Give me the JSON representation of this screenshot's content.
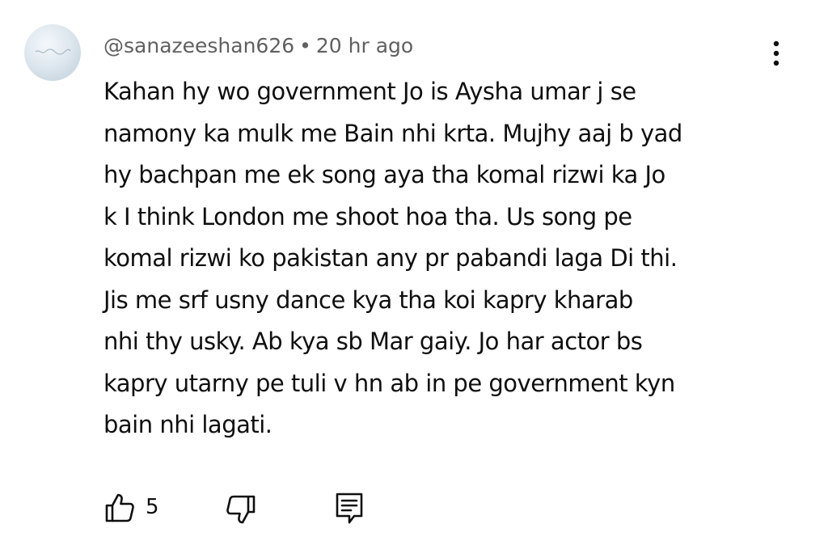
{
  "comment": {
    "author": "@sanazeeshan626",
    "separator": "•",
    "timestamp": "20 hr ago",
    "lines": [
      "Kahan hy wo government Jo is Aysha umar j se",
      "namony ka mulk me Bain nhi krta. Mujhy aaj b yad",
      "hy bachpan me ek song aya tha komal rizwi ka Jo",
      "k I think London me shoot hoa tha. Us song pe",
      "komal rizwi ko pakistan any pr pabandi laga Di thi.",
      "Jis me srf usny dance kya tha koi kapry kharab",
      "nhi thy usky. Ab kya sb Mar gaiy. Jo har actor bs",
      "kapry utarny pe tuli v hn ab in pe government kyn",
      "bain nhi lagati."
    ],
    "like_count": "5"
  },
  "icons": {
    "avatar": "avatar-image",
    "menu": "more-vert-icon",
    "like": "thumbs-up-icon",
    "dislike": "thumbs-down-icon",
    "reply": "comment-reply-icon"
  },
  "colors": {
    "text": "#0f0f0f",
    "meta": "#606060",
    "background": "#ffffff"
  }
}
